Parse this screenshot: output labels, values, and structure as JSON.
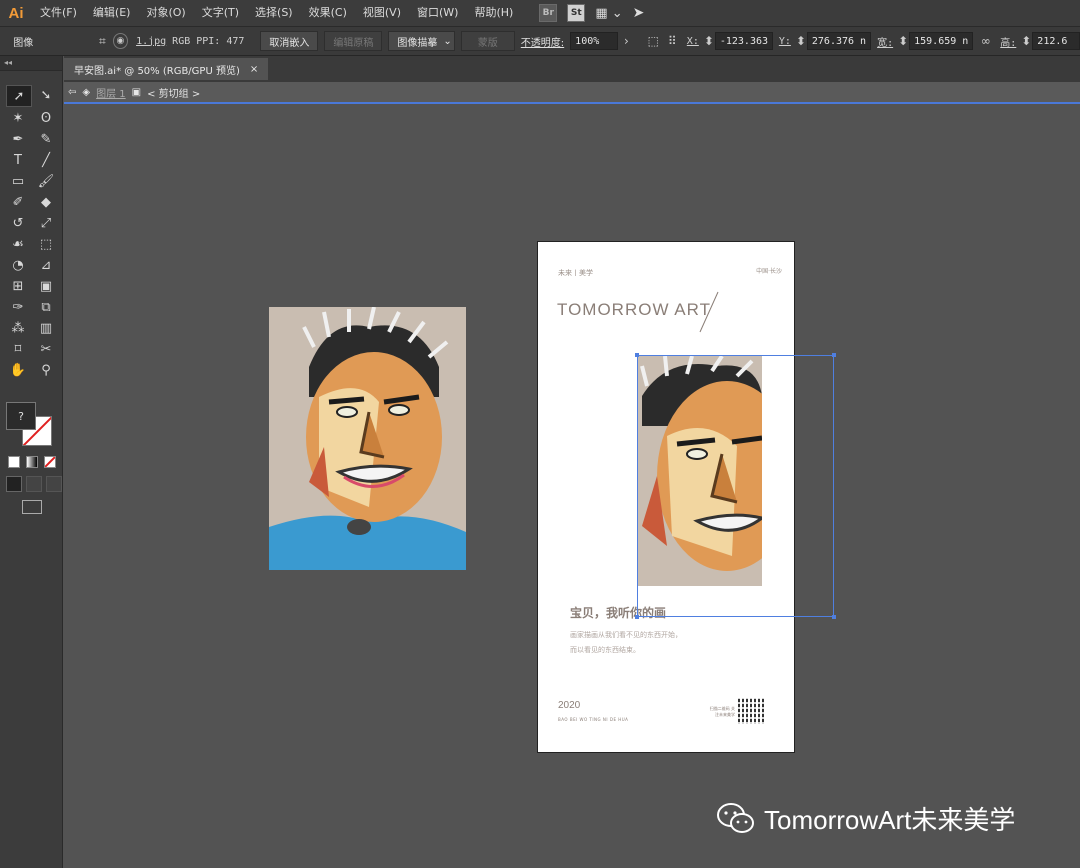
{
  "app": {
    "logo": "Ai"
  },
  "menubar": {
    "items": [
      "文件(F)",
      "编辑(E)",
      "对象(O)",
      "文字(T)",
      "选择(S)",
      "效果(C)",
      "视图(V)",
      "窗口(W)",
      "帮助(H)"
    ],
    "br_label": "Br",
    "st_label": "St"
  },
  "controlbar": {
    "type_label": "图像",
    "filename": "1.jpg",
    "color_mode": "RGB",
    "ppi": "PPI: 477",
    "unembed_btn": "取消嵌入",
    "edit_original_btn": "编辑原稿",
    "image_trace_btn": "图像描摹",
    "mask_btn": "蒙版",
    "opacity_label": "不透明度:",
    "opacity_value": "100%",
    "x_label": "X:",
    "x_value": "-123.363",
    "y_label": "Y:",
    "y_value": "276.376 n",
    "w_label": "宽:",
    "w_value": "159.659 n",
    "h_label": "高:",
    "h_value": "212.6"
  },
  "document": {
    "tab_title": "早安图.ai* @ 50% (RGB/GPU 预览)",
    "tab_close": "×",
    "breadcrumb_layer": "图层 1",
    "breadcrumb_group": "< 剪切组 >"
  },
  "toolbar": {
    "collapse": "◂◂",
    "fill_question": "?"
  },
  "artboard": {
    "brand": "未来丨美学",
    "region": "中国·长沙",
    "title": "TOMORROW ART",
    "headline": "宝贝，我听你的画",
    "body_line1": "画家描画从我们看不见的东西开始，",
    "body_line2": "而以看见的东西结束。",
    "year": "2020",
    "subline": "BAO BEI WO TING NI DE HUA",
    "scan_text": "扫描二维码 关注未来美学"
  },
  "watermark": {
    "text": "TomorrowArt未来美学"
  },
  "colors": {
    "accent": "#4f7fe0",
    "logo": "#f29b38",
    "artboard_text": "#8a7e77"
  }
}
